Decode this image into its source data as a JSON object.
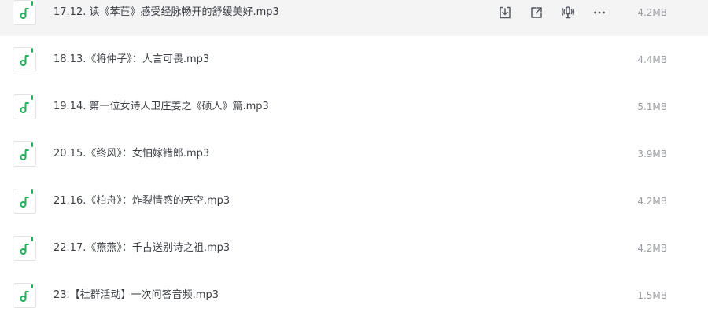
{
  "file_list": {
    "hovered_row_index": 0,
    "row_actions": [
      {
        "name": "download-icon"
      },
      {
        "name": "share-icon"
      },
      {
        "name": "podcast-icon"
      },
      {
        "name": "more-icon"
      }
    ],
    "items": [
      {
        "name": "17.12. 读《苯苣》感受经脉畅开的舒缓美好.mp3",
        "size": "4.2MB"
      },
      {
        "name": "18.13.《将仲子》：人言可畏.mp3",
        "size": "4.4MB"
      },
      {
        "name": "19.14. 第一位女诗人卫庄姜之《硕人》篇.mp3",
        "size": "5.1MB"
      },
      {
        "name": "20.15.《终风》：女怕嫁错郎.mp3",
        "size": "3.9MB"
      },
      {
        "name": "21.16.《柏舟》：炸裂情感的天空.mp3",
        "size": "4.2MB"
      },
      {
        "name": "22.17.《燕燕》：千古送别诗之祖.mp3",
        "size": "4.2MB"
      },
      {
        "name": "23.【社群活动】一次问答音频.mp3",
        "size": "1.5MB"
      }
    ],
    "colors": {
      "accent": "#22b05a",
      "hover_bg": "#f4f4f5"
    }
  }
}
